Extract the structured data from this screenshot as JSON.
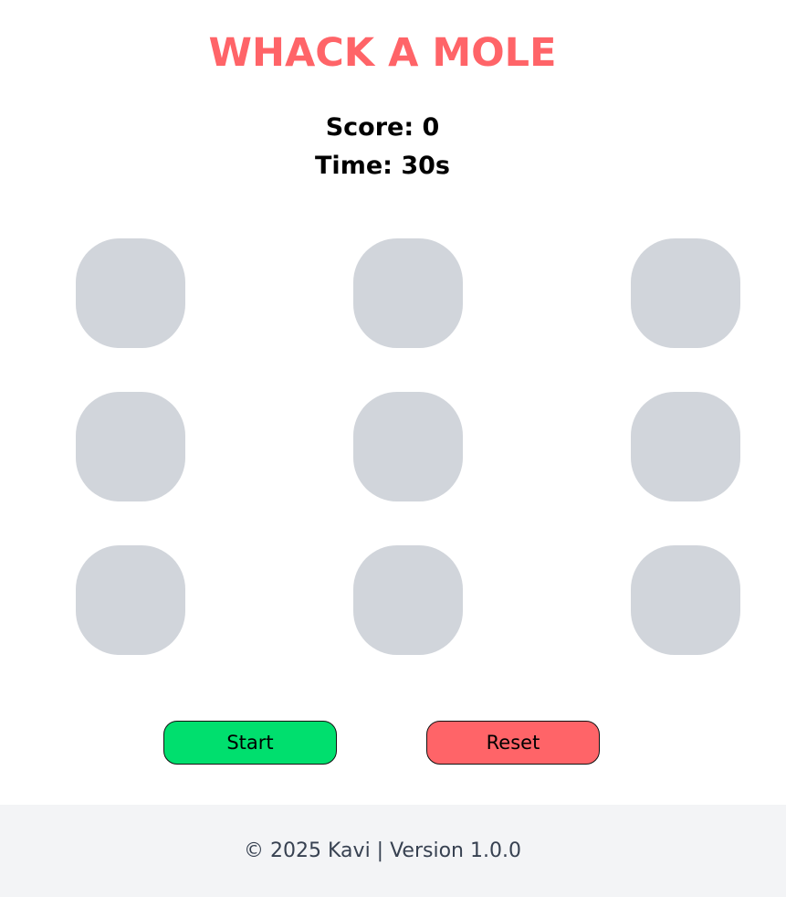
{
  "game": {
    "title": "WHACK A MOLE",
    "score_text": "Score: 0",
    "time_text": "Time: 30s",
    "score": 0,
    "time_remaining_s": 30,
    "grid": {
      "rows": 3,
      "columns": 3,
      "holes_with_mole": 0
    }
  },
  "controls": {
    "start_label": "Start",
    "reset_label": "Reset",
    "start_color": "#00df6e",
    "reset_color": "#ff6468"
  },
  "footer": {
    "text": "© 2025 Kavi | Version 1.0.0"
  },
  "colors": {
    "title": "#ff6468",
    "hole": "#d1d5db",
    "footer_bg": "#f3f4f6",
    "footer_text": "#374151"
  }
}
